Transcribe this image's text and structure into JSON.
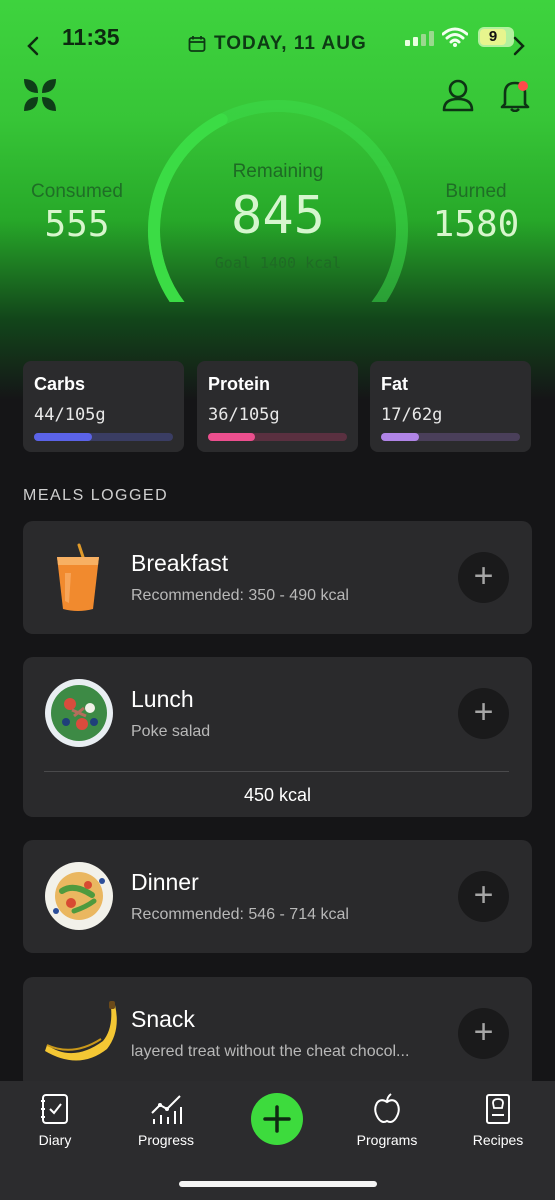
{
  "status": {
    "time": "11:35",
    "battery": "9"
  },
  "header": {
    "date": "TODAY, 11 AUG"
  },
  "summary": {
    "consumed_label": "Consumed",
    "consumed_value": "555",
    "remaining_label": "Remaining",
    "remaining_value": "845",
    "goal_text": "Goal 1400 kcal",
    "burned_label": "Burned",
    "burned_value": "1580",
    "progress_fraction": 0.4
  },
  "macros": [
    {
      "name": "Carbs",
      "value": "44/105g",
      "fraction": 0.42,
      "color": "#5b63e8",
      "track": "#3a3d63"
    },
    {
      "name": "Protein",
      "value": "36/105g",
      "fraction": 0.34,
      "color": "#ec4f8e",
      "track": "#5a3040"
    },
    {
      "name": "Fat",
      "value": "17/62g",
      "fraction": 0.27,
      "color": "#b084e6",
      "track": "#4a3f5a"
    }
  ],
  "meals_title": "MEALS LOGGED",
  "meals": [
    {
      "name": "Breakfast",
      "sub": "Recommended: 350 - 490  kcal"
    },
    {
      "name": "Lunch",
      "sub": "Poke salad",
      "kcal": "450 kcal"
    },
    {
      "name": "Dinner",
      "sub": "Recommended: 546 - 714  kcal"
    },
    {
      "name": "Snack",
      "sub": "layered treat without the cheat chocol..."
    }
  ],
  "nav": [
    {
      "label": "Diary"
    },
    {
      "label": "Progress"
    },
    {
      "label": "Programs"
    },
    {
      "label": "Recipes"
    }
  ],
  "colors": {
    "accent": "#3ddb3d",
    "card": "#2a2a2c",
    "background": "#151517"
  }
}
